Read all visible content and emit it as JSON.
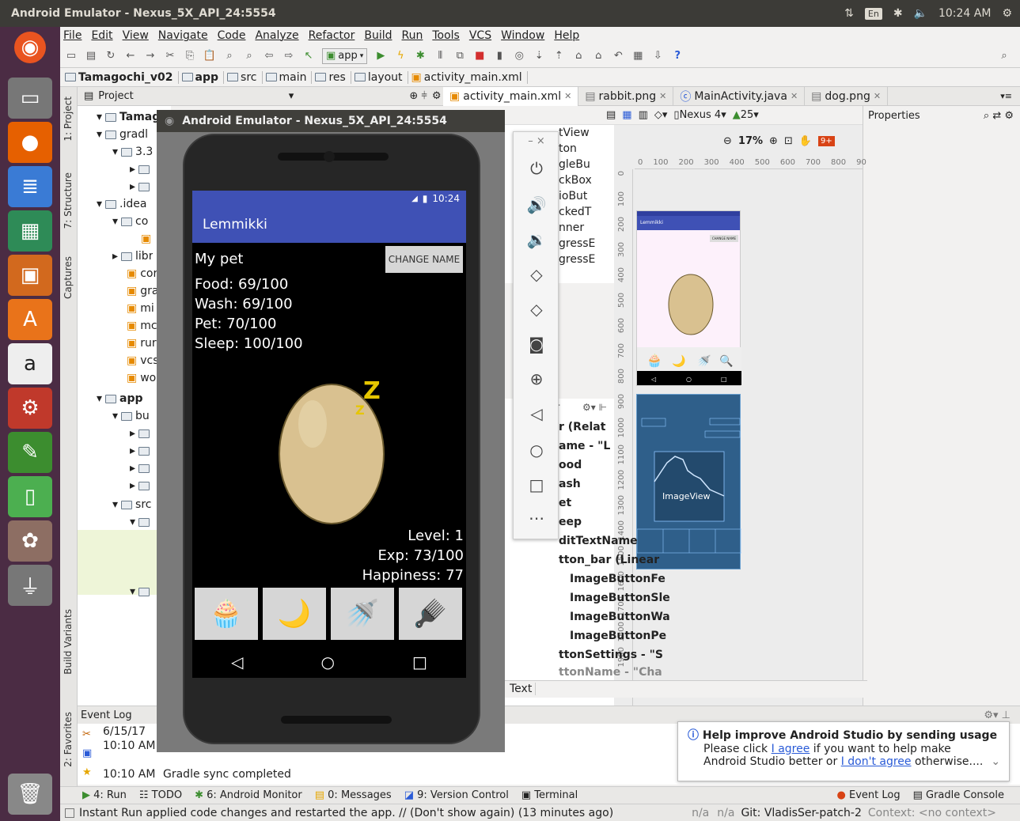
{
  "system": {
    "window_title": "Android Emulator - Nexus_5X_API_24:5554",
    "keyboard": "En",
    "time": "10:24 AM"
  },
  "menu": [
    "File",
    "Edit",
    "View",
    "Navigate",
    "Code",
    "Analyze",
    "Refactor",
    "Build",
    "Run",
    "Tools",
    "VCS",
    "Window",
    "Help"
  ],
  "toolbar": {
    "run_config": "app"
  },
  "breadcrumb": [
    "Tamagochi_v02",
    "app",
    "src",
    "main",
    "res",
    "layout",
    "activity_main.xml"
  ],
  "project_panel": {
    "header": "Project",
    "tree": [
      "Tamago",
      "gradl",
      "3.3",
      ".idea",
      "co",
      "libr",
      "cor",
      "gra",
      "mi",
      "mc",
      "rur",
      "vcs",
      "wo",
      "app",
      "bu",
      "src"
    ]
  },
  "left_tools": [
    "1: Project",
    "7: Structure",
    "Captures",
    "Build Variants",
    "2: Favorites"
  ],
  "editor_tabs": [
    {
      "label": "activity_main.xml",
      "active": true
    },
    {
      "label": "rabbit.png",
      "active": false
    },
    {
      "label": "MainActivity.java",
      "active": false
    },
    {
      "label": "dog.png",
      "active": false
    }
  ],
  "design": {
    "device": "Nexus 4",
    "api": "25",
    "zoom": "17%",
    "properties": "Properties",
    "palette_items": [
      "tView",
      "ton",
      "gleBu",
      "ckBox",
      "ioBut",
      "ckedT",
      "nner",
      "gressE",
      "gressE"
    ],
    "ruler_top": [
      "0",
      "100",
      "200",
      "300",
      "400",
      "500",
      "600",
      "700",
      "800",
      "90"
    ],
    "ruler_left": [
      "0",
      "100",
      "200",
      "300",
      "400",
      "500",
      "600",
      "700",
      "800",
      "900",
      "1000",
      "1100",
      "1200",
      "1300",
      "1400",
      "1500",
      "1600",
      "1700",
      "1800",
      "1900"
    ],
    "preview_app_title": "Lemmikki",
    "preview_button": "CHANGE NAME",
    "blueprint_label": "ImageView",
    "tree_items": [
      "r (Relat",
      "ame - \"L",
      "ood",
      "ash",
      "et",
      "eep",
      "ditTextName",
      "tton_bar (Linear",
      "ImageButtonFe",
      "ImageButtonSle",
      "ImageButtonWa",
      "ImageButtonPe",
      "ttonSettings - \"S",
      "ttonName - \"Cha"
    ],
    "text_tab": "Text",
    "tree_header": "Tr"
  },
  "event_log": {
    "title": "Event Log",
    "date": "6/15/17",
    "time1": "10:10 AM",
    "time2": "10:10 AM",
    "message": "Gradle sync completed"
  },
  "notification": {
    "title": "Help improve Android Studio by sending usage st",
    "line1_pre": "Please click ",
    "agree": "I agree",
    "line1_post": " if you want to help make",
    "line2_pre": "Android Studio better or ",
    "disagree": "I don't agree",
    "line2_post": " otherwise...."
  },
  "tool_windows": [
    "4: Run",
    "TODO",
    "6: Android Monitor",
    "0: Messages",
    "9: Version Control",
    "Terminal",
    "Event Log",
    "Gradle Console"
  ],
  "status": {
    "message": "Instant Run applied code changes and restarted the app. // (Don't show again) (13 minutes ago)",
    "na1": "n/a",
    "na2": "n/a",
    "git": "Git: VladisSer-patch-2",
    "context": "Context: <no context>"
  },
  "emulator": {
    "title": "Android Emulator - Nexus_5X_API_24:5554",
    "phone_time": "10:24",
    "app_title": "Lemmikki",
    "pet_name": "My pet",
    "change_name": "CHANGE NAME",
    "food": "Food: 69/100",
    "wash": "Wash: 69/100",
    "pet": "Pet: 70/100",
    "sleep": "Sleep: 100/100",
    "sleep_glyph": "Z",
    "level": "Level: 1",
    "exp": "Exp: 73/100",
    "happiness": "Happiness: 77"
  },
  "colors": {
    "primary": "#3f51b5",
    "launcher": "#4b2c44",
    "egg": "#d9c190"
  }
}
